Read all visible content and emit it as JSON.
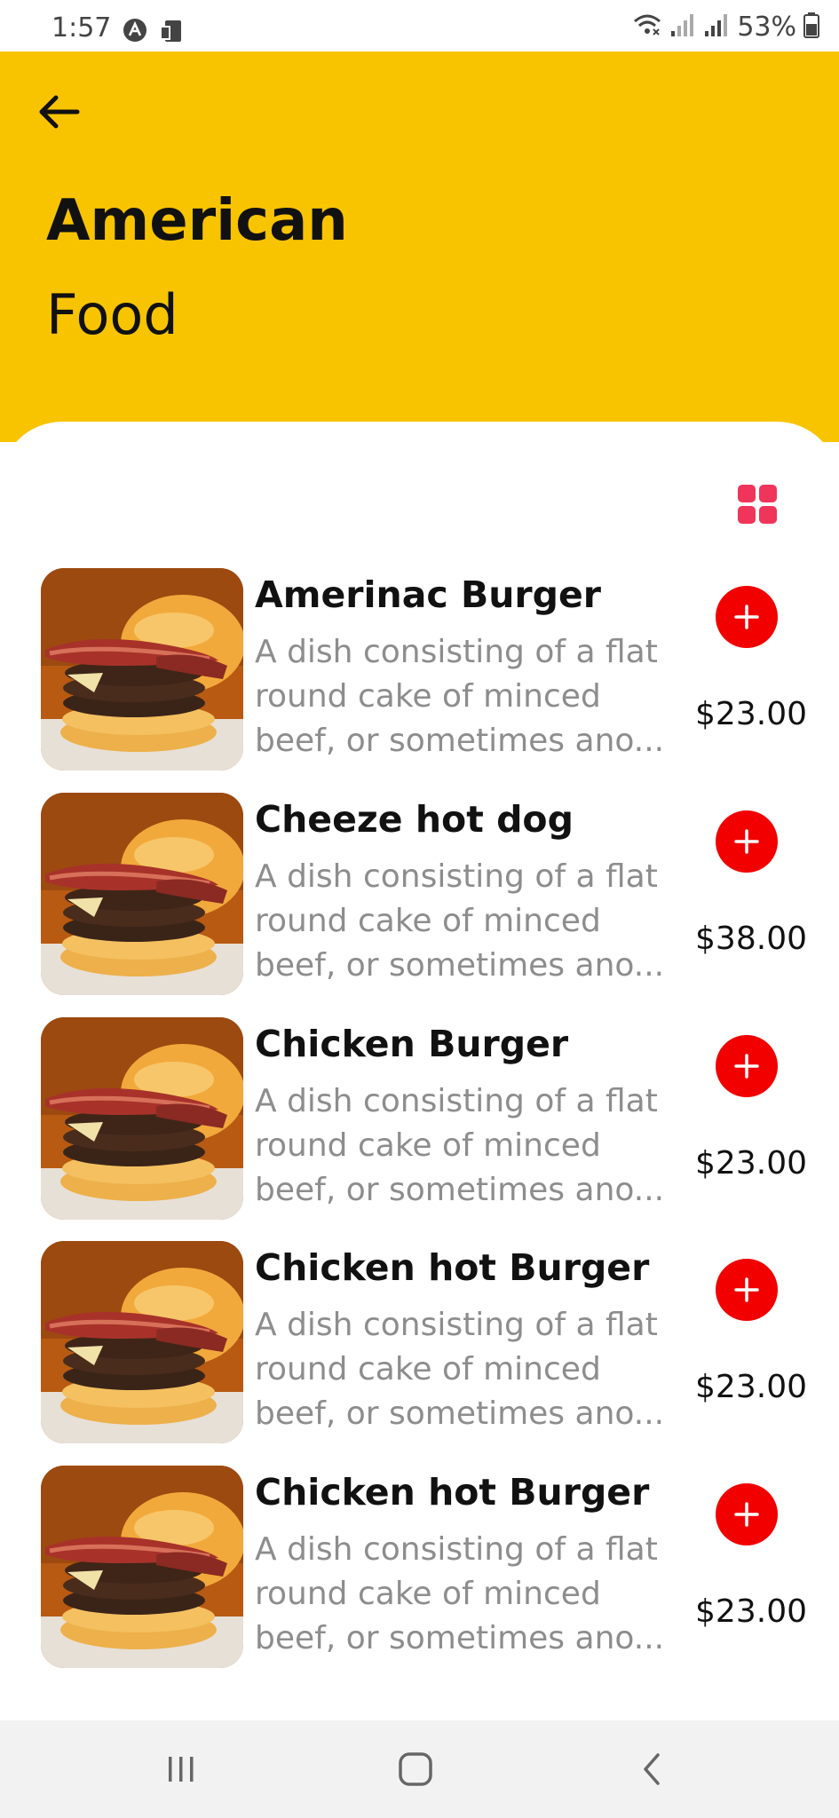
{
  "status_bar": {
    "time": "1:57",
    "battery": "53%",
    "icons": [
      "app-a-icon",
      "device-icon",
      "wifi-icon",
      "signal-icon",
      "signal-icon",
      "battery-icon"
    ]
  },
  "header": {
    "background_color": "#F8C400",
    "back_icon": "arrow-left-icon",
    "title_line1": "American",
    "title_line2": "Food"
  },
  "toolbar": {
    "grid_icon": "grid-view-icon",
    "accent_color": "#F0355A"
  },
  "items": [
    {
      "name": "Amerinac Burger",
      "description": "A dish consisting of a flat round cake of minced beef, or sometimes ano...",
      "price": "$23.00"
    },
    {
      "name": "Cheeze hot dog",
      "description": "A dish consisting of a flat round cake of minced beef, or sometimes ano...",
      "price": "$38.00"
    },
    {
      "name": "Chicken Burger",
      "description": "A dish consisting of a flat round cake of minced beef, or sometimes ano...",
      "price": "$23.00"
    },
    {
      "name": "Chicken hot Burger",
      "description": "A dish consisting of a flat round cake of minced beef, or sometimes ano...",
      "price": "$23.00"
    },
    {
      "name": "Chicken hot Burger",
      "description": "A dish consisting of a flat round cake of minced beef, or sometimes ano...",
      "price": "$23.00"
    }
  ],
  "add_button_color": "#F20000",
  "nav_bar": {
    "icons": [
      "recent-apps-icon",
      "home-icon",
      "back-icon"
    ]
  }
}
